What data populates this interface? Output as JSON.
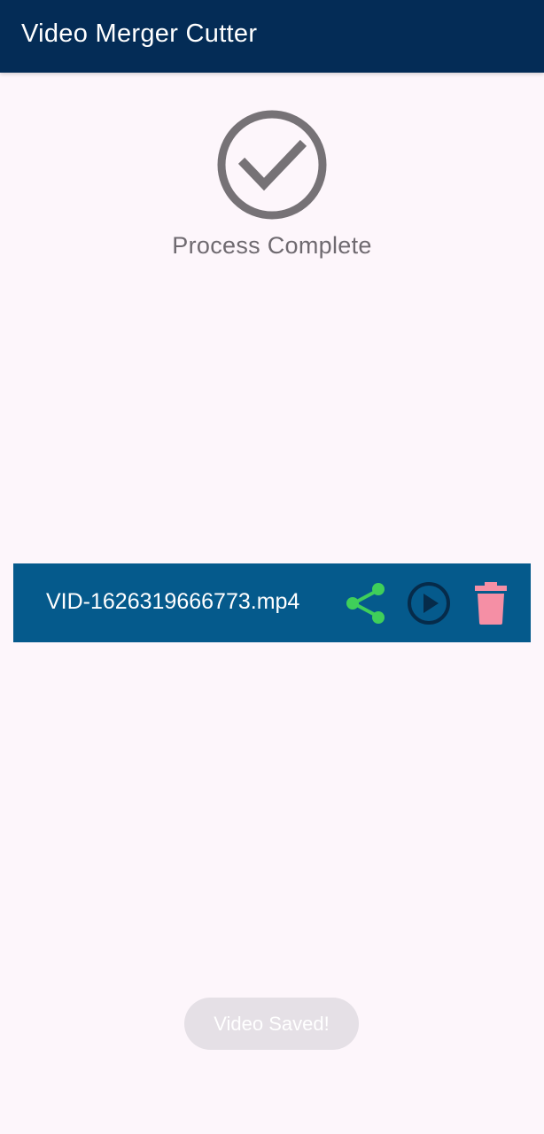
{
  "app_bar": {
    "title": "Video Merger Cutter",
    "background": "#042c56"
  },
  "status": {
    "icon": "check-circle-icon",
    "message": "Process Complete"
  },
  "file_item": {
    "name": "VID-1626319666773.mp4",
    "background": "#055a8c",
    "actions": [
      {
        "name": "share",
        "icon": "share-icon",
        "color": "#3fcf5a"
      },
      {
        "name": "play",
        "icon": "play-circle-icon",
        "color": "#062b4a"
      },
      {
        "name": "delete",
        "icon": "trash-icon",
        "color": "#f58fa5"
      }
    ]
  },
  "toast": {
    "message": "Video Saved!"
  }
}
